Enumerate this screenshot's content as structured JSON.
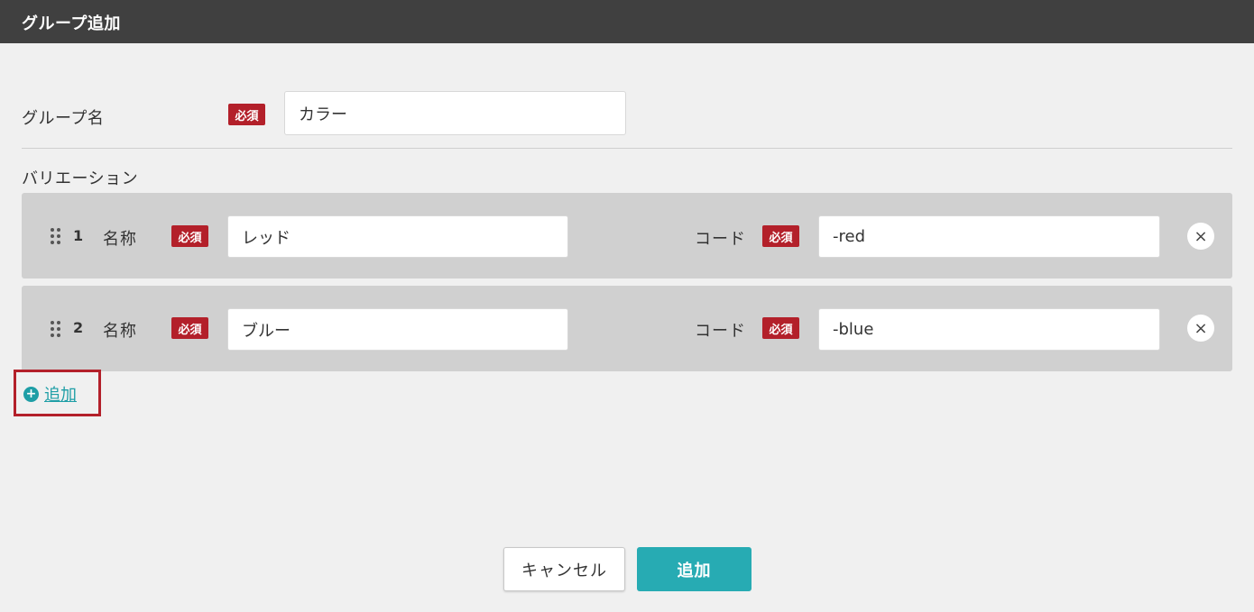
{
  "dialog": {
    "title": "グループ追加"
  },
  "group_name": {
    "label": "グループ名",
    "required_badge": "必須",
    "value": "カラー"
  },
  "variations": {
    "label": "バリエーション",
    "name_label": "名称",
    "code_label": "コード",
    "required_badge": "必須",
    "items": [
      {
        "index": "1",
        "name": "レッド",
        "code": "-red"
      },
      {
        "index": "2",
        "name": "ブルー",
        "code": "-blue"
      }
    ],
    "remove_icon": "×",
    "add_label": "追加",
    "add_icon": "+"
  },
  "footer": {
    "cancel_label": "キャンセル",
    "submit_label": "追加"
  },
  "colors": {
    "accent": "#27abb3",
    "required": "#b3202a",
    "titlebar": "#404040"
  }
}
